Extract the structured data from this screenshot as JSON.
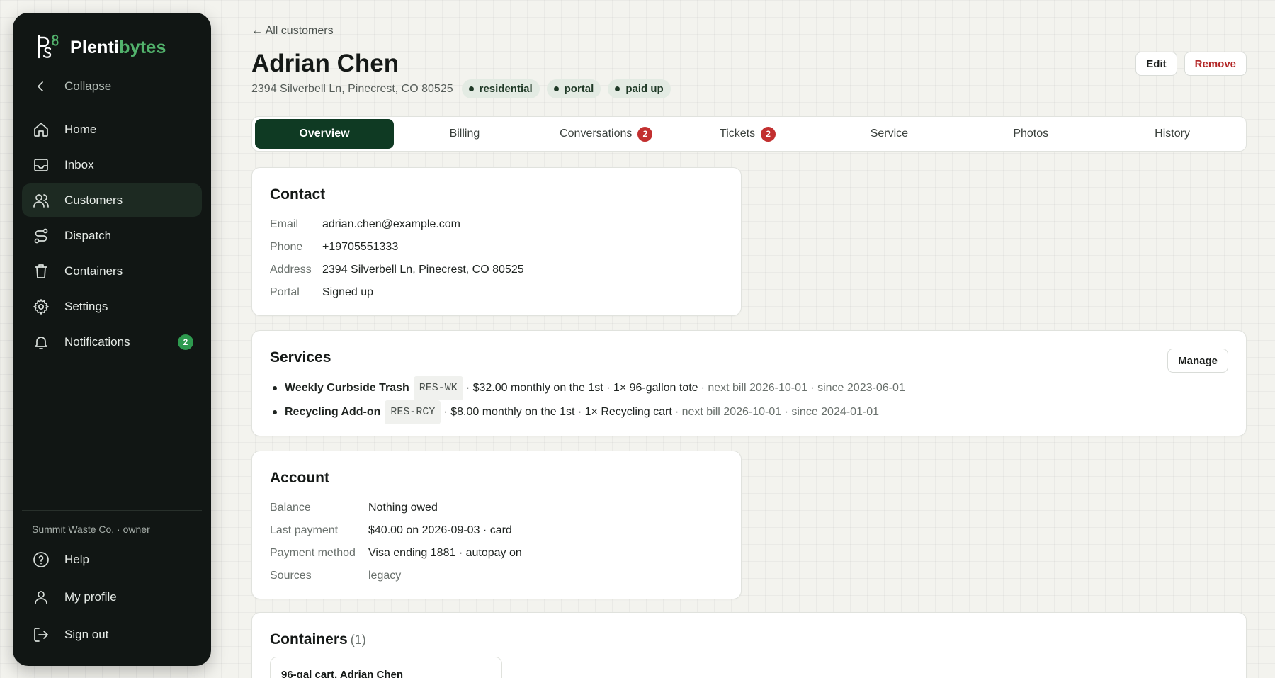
{
  "brand": {
    "name_a": "Plenti",
    "name_b": "bytes"
  },
  "sidebar": {
    "collapse_label": "Collapse",
    "items": [
      {
        "label": "Home",
        "icon": "home-icon"
      },
      {
        "label": "Inbox",
        "icon": "inbox-icon"
      },
      {
        "label": "Customers",
        "icon": "users-icon"
      },
      {
        "label": "Dispatch",
        "icon": "route-icon"
      },
      {
        "label": "Containers",
        "icon": "trash-can-icon"
      },
      {
        "label": "Settings",
        "icon": "gear-icon"
      },
      {
        "label": "Notifications",
        "icon": "bell-icon",
        "badge": "2"
      }
    ],
    "org_label": "Summit Waste Co. · owner",
    "footer_items": [
      {
        "label": "Help",
        "icon": "help-circle-icon"
      },
      {
        "label": "My profile",
        "icon": "user-icon"
      },
      {
        "label": "Sign out",
        "icon": "sign-out-icon"
      }
    ]
  },
  "header": {
    "back_link": "← All customers",
    "title": "Adrian Chen",
    "address": "2394 Silverbell Ln, Pinecrest, CO 80525",
    "tags": [
      "residential",
      "portal",
      "paid up"
    ],
    "edit_label": "Edit",
    "remove_label": "Remove"
  },
  "tabs": [
    {
      "label": "Overview"
    },
    {
      "label": "Billing"
    },
    {
      "label": "Conversations",
      "badge": "2"
    },
    {
      "label": "Tickets",
      "badge": "2"
    },
    {
      "label": "Service"
    },
    {
      "label": "Photos"
    },
    {
      "label": "History"
    }
  ],
  "contact": {
    "title": "Contact",
    "rows": [
      {
        "key": "Email",
        "value": "adrian.chen@example.com"
      },
      {
        "key": "Phone",
        "value": "+19705551333"
      },
      {
        "key": "Address",
        "value": "2394 Silverbell Ln, Pinecrest, CO 80525"
      },
      {
        "key": "Portal",
        "value": "Signed up"
      }
    ]
  },
  "services": {
    "title": "Services",
    "manage_label": "Manage",
    "items": [
      {
        "name": "Weekly Curbside Trash",
        "code": "RES-WK",
        "detail": "· $32.00 monthly on the 1st · 1× 96-gallon tote",
        "meta": "· next bill 2026-10-01 · since 2023-06-01"
      },
      {
        "name": "Recycling Add-on",
        "code": "RES-RCY",
        "detail": "· $8.00 monthly on the 1st · 1× Recycling cart",
        "meta": "· next bill 2026-10-01 · since 2024-01-01"
      }
    ]
  },
  "account": {
    "title": "Account",
    "rows": [
      {
        "key": "Balance",
        "value": "Nothing owed"
      },
      {
        "key": "Last payment",
        "value": "$40.00 on 2026-09-03 · card"
      },
      {
        "key": "Payment method",
        "value": "Visa ending 1881 · autopay on"
      },
      {
        "key": "Sources",
        "value": "legacy"
      }
    ]
  },
  "containers": {
    "title": "Containers",
    "count": "(1)",
    "items": [
      {
        "label": "96-gal cart, Adrian Chen"
      }
    ]
  },
  "colors": {
    "sidebar_bg": "#111614",
    "brand_green": "#52b26c",
    "active_tab": "#0f3a23",
    "badge_red": "#c22f2f",
    "notif_badge": "#2e9a4f",
    "danger": "#b32727"
  }
}
